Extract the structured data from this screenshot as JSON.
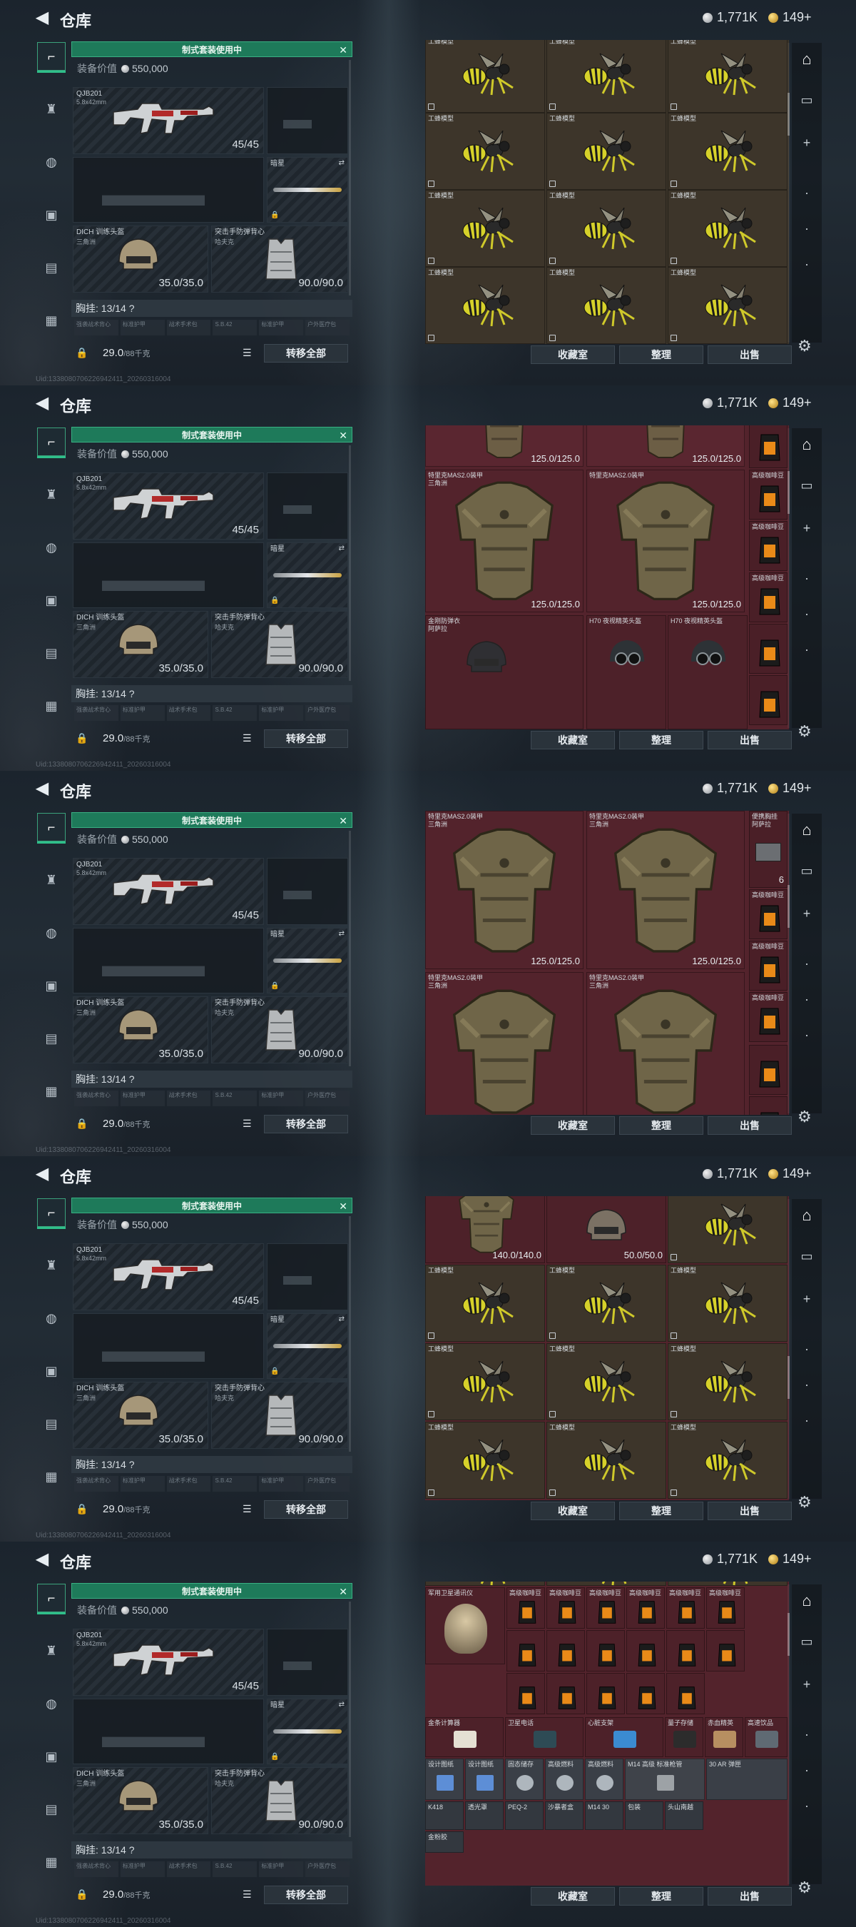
{
  "app": {
    "title": "仓库",
    "currency_silver": "1,771K",
    "currency_gold": "149+",
    "watermark": "Uid:1338080706226942411_20260316004"
  },
  "equipment": {
    "banner": "制式套装使用中",
    "value_label": "装备价值",
    "value": "550,000",
    "weapon": {
      "name": "QJB201",
      "caliber": "5.8x42mm",
      "ammo": "45/45"
    },
    "melee_label": "暗星",
    "helmet": {
      "name": "DICH 训练头盔",
      "sub": "三角洲",
      "durability": "35.0/35.0"
    },
    "armor": {
      "name": "突击手防弹背心",
      "sub": "哈夫克",
      "durability": "90.0/90.0"
    },
    "chest_rig": "胸挂: 13/14 ?",
    "subslots": [
      "强袭战术背心",
      "标准护甲",
      "战术手术包",
      "S.B.42",
      "标准护甲",
      "户外医疗包"
    ],
    "weight": "29.0",
    "weight_unit": "/88千克",
    "transfer_all": "转移全部"
  },
  "stash_buttons": {
    "collection": "收藏室",
    "sort": "整理",
    "sell": "出售"
  },
  "screens": [
    {
      "stash_theme": "dark",
      "rows": [
        {
          "items": [
            {
              "name": "工蜂模型"
            },
            {
              "name": "工蜂模型"
            },
            {
              "name": "工蜂模型"
            }
          ]
        },
        {
          "items": [
            {
              "name": "工蜂模型"
            },
            {
              "name": "工蜂模型"
            },
            {
              "name": "工蜂模型"
            }
          ]
        },
        {
          "items": [
            {
              "name": "工蜂模型"
            },
            {
              "name": "工蜂模型"
            },
            {
              "name": "工蜂模型"
            }
          ]
        },
        {
          "items": [
            {
              "name": "工蜂模型"
            },
            {
              "name": "工蜂模型"
            },
            {
              "name": "工蜂模型"
            }
          ]
        }
      ]
    },
    {
      "stash_theme": "maroon",
      "top_vals": [
        "125.0/125.0",
        "125.0/125.0"
      ],
      "vests": [
        {
          "name": "特里克MAS2.0装甲",
          "sub": "三角洲",
          "durability": "125.0/125.0"
        },
        {
          "name": "特里克MAS2.0装甲",
          "sub": "",
          "durability": "125.0/125.0"
        }
      ],
      "bottom": [
        {
          "name": "金刚防弹衣",
          "sub": "阿萨拉"
        },
        {
          "name": "H70 夜视精英头盔"
        },
        {
          "name": "H70 夜视精英头盔"
        }
      ],
      "side": [
        {
          "name": "高级咖啡豆"
        },
        {
          "name": "高级咖啡豆"
        },
        {
          "name": "高级咖啡豆"
        }
      ]
    },
    {
      "stash_theme": "maroon",
      "vests": [
        {
          "name": "特里克MAS2.0装甲",
          "sub": "三角洲",
          "durability": "125.0/125.0"
        },
        {
          "name": "特里克MAS2.0装甲",
          "sub": "三角洲",
          "durability": "125.0/125.0"
        },
        {
          "name": "特里克MAS2.0装甲",
          "sub": "三角洲",
          "durability": ""
        },
        {
          "name": "特里克MAS2.0装甲",
          "sub": "三角洲",
          "durability": ""
        }
      ],
      "side": [
        {
          "name": "便携胸挂",
          "sub": "阿萨拉",
          "count": "6"
        },
        {
          "name": "高级咖啡豆"
        },
        {
          "name": "高级咖啡豆"
        },
        {
          "name": "高级咖啡豆"
        }
      ]
    },
    {
      "stash_theme": "mixed",
      "top_vals": [
        "140.0/140.0",
        "50.0/50.0"
      ],
      "rows": [
        {
          "items": [
            {
              "name": "工蜂模型"
            },
            {
              "name": "工蜂模型"
            },
            {
              "name": "工蜂模型"
            }
          ]
        },
        {
          "items": [
            {
              "name": "工蜂模型"
            },
            {
              "name": "工蜂模型"
            },
            {
              "name": "工蜂模型"
            }
          ]
        },
        {
          "items": [
            {
              "name": "工蜂模型"
            },
            {
              "name": "工蜂模型"
            },
            {
              "name": "工蜂模型"
            }
          ]
        }
      ]
    },
    {
      "stash_theme": "maroon",
      "labels": {
        "tablet": "军用卫星通讯仪",
        "coffee": "高级咖啡豆",
        "intel": "金条计算器",
        "phone": "卫星电话",
        "heart": "心脏支架",
        "wig": "量子存储",
        "scope": "赤血精英",
        "drink": "高速饮品",
        "design": "设计图纸",
        "storage": "固态储存",
        "fuel": "高级燃料",
        "gun": "M14 高级 标准枪管",
        "ar": "30 AR 弹匣",
        "k418": "K418",
        "pcb": "PEQ-2",
        "m14": "M14 30",
        "n1": "金粉胶",
        "n2": "透光罩",
        "n3": "沙暴者盒",
        "n4": "包装",
        "n5": "头山南越"
      }
    }
  ]
}
